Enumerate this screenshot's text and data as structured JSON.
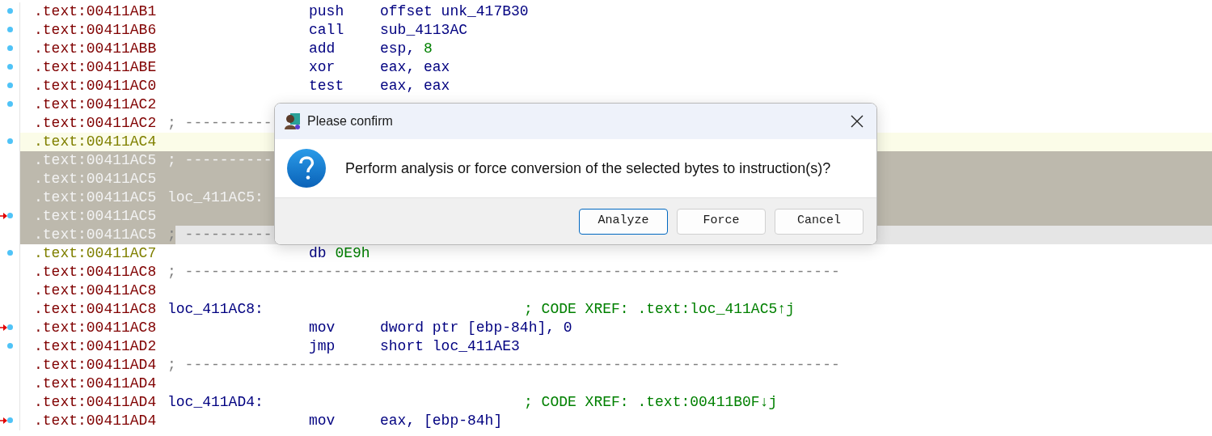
{
  "listing": {
    "rows": [
      {
        "address": ".text:00411AB1",
        "unexplored": false,
        "selected": false,
        "current": false,
        "dot": true,
        "arrow": false,
        "kind": "insn",
        "mnemonic": "push",
        "operands": [
          {
            "text": "offset unk_417B30",
            "kind": "name"
          }
        ]
      },
      {
        "address": ".text:00411AB6",
        "unexplored": false,
        "selected": false,
        "current": false,
        "dot": true,
        "arrow": false,
        "kind": "insn",
        "mnemonic": "call",
        "operands": [
          {
            "text": "sub_4113AC",
            "kind": "name"
          }
        ]
      },
      {
        "address": ".text:00411ABB",
        "unexplored": false,
        "selected": false,
        "current": false,
        "dot": true,
        "arrow": false,
        "kind": "insn",
        "mnemonic": "add",
        "operands": [
          {
            "text": "esp, ",
            "kind": "name"
          },
          {
            "text": "8",
            "kind": "num"
          }
        ]
      },
      {
        "address": ".text:00411ABE",
        "unexplored": false,
        "selected": false,
        "current": false,
        "dot": true,
        "arrow": false,
        "kind": "insn",
        "mnemonic": "xor",
        "operands": [
          {
            "text": "eax, eax",
            "kind": "name"
          }
        ]
      },
      {
        "address": ".text:00411AC0",
        "unexplored": false,
        "selected": false,
        "current": false,
        "dot": true,
        "arrow": false,
        "kind": "insn",
        "mnemonic": "test",
        "operands": [
          {
            "text": "eax, eax",
            "kind": "name"
          }
        ]
      },
      {
        "address": ".text:00411AC2",
        "unexplored": false,
        "selected": false,
        "current": false,
        "dot": true,
        "arrow": false,
        "kind": "blank"
      },
      {
        "address": ".text:00411AC2",
        "unexplored": false,
        "selected": false,
        "current": false,
        "dot": false,
        "arrow": false,
        "kind": "sep",
        "text": "; ----------"
      },
      {
        "address": ".text:00411AC4",
        "unexplored": true,
        "selected": false,
        "current": true,
        "dot": true,
        "arrow": false,
        "kind": "blank"
      },
      {
        "address": ".text:00411AC5",
        "unexplored": false,
        "selected": true,
        "current": false,
        "dot": false,
        "arrow": false,
        "kind": "sep",
        "text": "; ----------"
      },
      {
        "address": ".text:00411AC5",
        "unexplored": false,
        "selected": true,
        "current": false,
        "dot": false,
        "arrow": false,
        "kind": "blank"
      },
      {
        "address": ".text:00411AC5",
        "unexplored": false,
        "selected": true,
        "current": false,
        "dot": false,
        "arrow": false,
        "kind": "label",
        "label": "loc_411AC5:"
      },
      {
        "address": ".text:00411AC5",
        "unexplored": false,
        "selected": true,
        "current": false,
        "dot": true,
        "arrow": true,
        "kind": "blank"
      },
      {
        "address": ".text:00411AC5",
        "unexplored": false,
        "selected": true,
        "current": true,
        "dot": false,
        "arrow": false,
        "kind": "sep",
        "text": "; ----------"
      },
      {
        "address": ".text:00411AC7",
        "unexplored": true,
        "selected": false,
        "current": false,
        "dot": true,
        "arrow": false,
        "kind": "data",
        "mnemonic": "db",
        "operands": [
          {
            "text": "0E9h",
            "kind": "num"
          }
        ]
      },
      {
        "address": ".text:00411AC8",
        "unexplored": false,
        "selected": false,
        "current": false,
        "dot": false,
        "arrow": false,
        "kind": "sep",
        "text": "; ---------------------------------------------------------------------------"
      },
      {
        "address": ".text:00411AC8",
        "unexplored": false,
        "selected": false,
        "current": false,
        "dot": false,
        "arrow": false,
        "kind": "blank"
      },
      {
        "address": ".text:00411AC8",
        "unexplored": false,
        "selected": false,
        "current": false,
        "dot": false,
        "arrow": false,
        "kind": "label",
        "label": "loc_411AC8:",
        "comment": "; CODE XREF: .text:loc_411AC5↑j"
      },
      {
        "address": ".text:00411AC8",
        "unexplored": false,
        "selected": false,
        "current": false,
        "dot": true,
        "arrow": true,
        "kind": "insn",
        "mnemonic": "mov",
        "operands": [
          {
            "text": "dword ptr [ebp-84h], 0",
            "kind": "name"
          }
        ]
      },
      {
        "address": ".text:00411AD2",
        "unexplored": false,
        "selected": false,
        "current": false,
        "dot": true,
        "arrow": false,
        "kind": "insn",
        "mnemonic": "jmp",
        "operands": [
          {
            "text": "short loc_411AE3",
            "kind": "name"
          }
        ]
      },
      {
        "address": ".text:00411AD4",
        "unexplored": false,
        "selected": false,
        "current": false,
        "dot": false,
        "arrow": false,
        "kind": "sep",
        "text": "; ---------------------------------------------------------------------------"
      },
      {
        "address": ".text:00411AD4",
        "unexplored": false,
        "selected": false,
        "current": false,
        "dot": false,
        "arrow": false,
        "kind": "blank"
      },
      {
        "address": ".text:00411AD4",
        "unexplored": false,
        "selected": false,
        "current": false,
        "dot": false,
        "arrow": false,
        "kind": "label",
        "label": "loc_411AD4:",
        "comment": "; CODE XREF: .text:00411B0F↓j"
      },
      {
        "address": ".text:00411AD4",
        "unexplored": false,
        "selected": false,
        "current": false,
        "dot": true,
        "arrow": true,
        "kind": "insn",
        "mnemonic": "mov",
        "operands": [
          {
            "text": "eax, [ebp-84h]",
            "kind": "name"
          }
        ]
      }
    ]
  },
  "dialog": {
    "title": "Please confirm",
    "message": "Perform analysis or force conversion of the selected bytes to instruction(s)?",
    "buttons": [
      {
        "label": "Analyze",
        "default": true
      },
      {
        "label": "Force",
        "default": false
      },
      {
        "label": "Cancel",
        "default": false
      }
    ]
  }
}
